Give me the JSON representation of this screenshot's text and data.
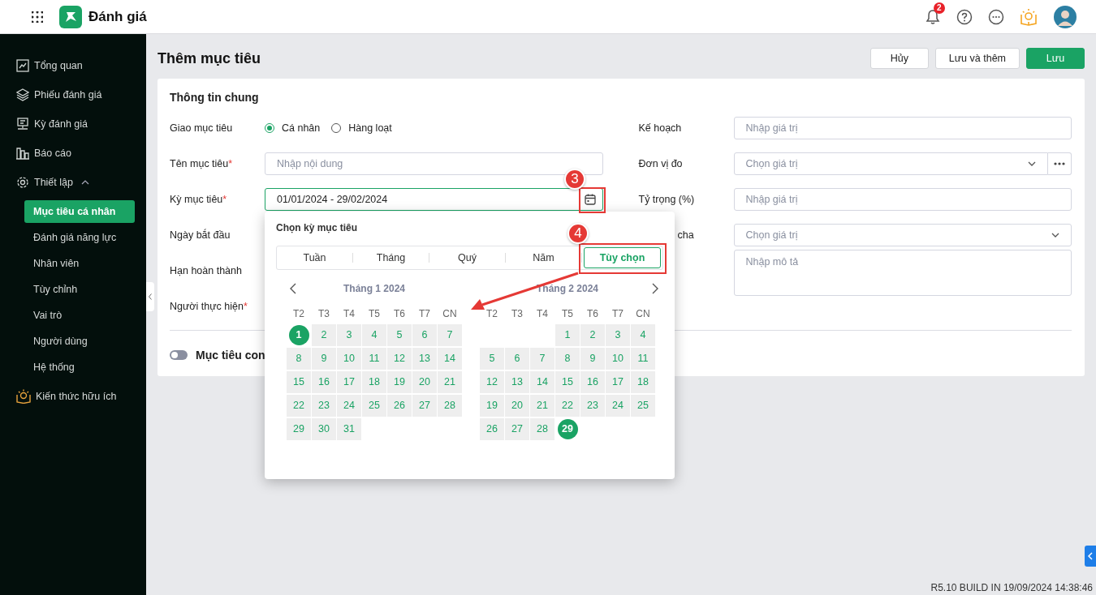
{
  "header": {
    "app_name": "Đánh giá",
    "notification_count": "2"
  },
  "sidebar": {
    "items": [
      {
        "label": "Tổng quan",
        "selected": false
      },
      {
        "label": "Phiếu đánh giá",
        "selected": false
      },
      {
        "label": "Kỳ đánh giá",
        "selected": false
      },
      {
        "label": "Báo cáo",
        "selected": false
      },
      {
        "label": "Thiết lập",
        "selected": false,
        "expanded": true,
        "children": [
          {
            "label": "Mục tiêu cá nhân",
            "selected": true
          },
          {
            "label": "Đánh giá năng lực",
            "selected": false
          },
          {
            "label": "Nhân viên",
            "selected": false
          },
          {
            "label": "Tùy chỉnh",
            "selected": false
          },
          {
            "label": "Vai trò",
            "selected": false
          },
          {
            "label": "Người dùng",
            "selected": false
          },
          {
            "label": "Hệ thống",
            "selected": false
          }
        ]
      },
      {
        "label": "Kiến thức hữu ích",
        "selected": false
      }
    ]
  },
  "page": {
    "title": "Thêm mục tiêu",
    "actions": [
      {
        "label": "Hủy",
        "kind": "secondary"
      },
      {
        "label": "Lưu và thêm",
        "kind": "secondary"
      },
      {
        "label": "Lưu",
        "kind": "primary"
      }
    ]
  },
  "form": {
    "section_title": "Thông tin chung",
    "left_fields": [
      {
        "kind": "radio",
        "label": "Giao mục tiêu",
        "options": [
          {
            "label": "Cá nhân",
            "selected": true
          },
          {
            "label": "Hàng loạt",
            "selected": false
          }
        ]
      },
      {
        "kind": "text",
        "label": "Tên mục tiêu",
        "required_mark": "*",
        "placeholder": "Nhập nội dung"
      },
      {
        "kind": "date_range",
        "label": "Kỳ mục tiêu",
        "required_mark": "*",
        "value": "01/01/2024 - 29/02/2024",
        "focused": true
      },
      {
        "kind": "covered",
        "label": "Ngày bắt đầu"
      },
      {
        "kind": "covered",
        "label": "Hạn hoàn thành"
      },
      {
        "kind": "covered",
        "label": "Người thực hiện",
        "required_mark": "*"
      }
    ],
    "right_fields": [
      {
        "kind": "text",
        "label": "Kế hoạch",
        "placeholder": "Nhập giá trị"
      },
      {
        "kind": "select_more",
        "label": "Đơn vị đo",
        "placeholder": "Chọn giá trị"
      },
      {
        "kind": "text",
        "label": "Tỷ trọng (%)",
        "placeholder": "Nhập giá trị"
      },
      {
        "kind": "select",
        "label": "cha",
        "label_clipped": true,
        "placeholder": "Chọn giá trị"
      },
      {
        "kind": "textarea",
        "placeholder": "Nhập mô tả"
      }
    ],
    "subgoal_toggle": {
      "label": "Mục tiêu con",
      "on": false
    }
  },
  "period_picker": {
    "title": "Chọn kỳ mục tiêu",
    "tabs": [
      {
        "label": "Tuần",
        "selected": false
      },
      {
        "label": "Tháng",
        "selected": false
      },
      {
        "label": "Quý",
        "selected": false
      },
      {
        "label": "Năm",
        "selected": false
      },
      {
        "label": "Tùy chọn",
        "selected": true
      }
    ],
    "months": [
      {
        "title": "Tháng 1 2024",
        "weekdays": [
          "T2",
          "T3",
          "T4",
          "T5",
          "T6",
          "T7",
          "CN"
        ],
        "weeks": [
          [
            {
              "day": "1",
              "selected": true
            },
            {
              "day": "2",
              "selected": false
            },
            {
              "day": "3",
              "selected": false
            },
            {
              "day": "4",
              "selected": false
            },
            {
              "day": "5",
              "selected": false
            },
            {
              "day": "6",
              "selected": false
            },
            {
              "day": "7",
              "selected": false
            }
          ],
          [
            {
              "day": "8",
              "selected": false
            },
            {
              "day": "9",
              "selected": false
            },
            {
              "day": "10",
              "selected": false
            },
            {
              "day": "11",
              "selected": false
            },
            {
              "day": "12",
              "selected": false
            },
            {
              "day": "13",
              "selected": false
            },
            {
              "day": "14",
              "selected": false
            }
          ],
          [
            {
              "day": "15",
              "selected": false
            },
            {
              "day": "16",
              "selected": false
            },
            {
              "day": "17",
              "selected": false
            },
            {
              "day": "18",
              "selected": false
            },
            {
              "day": "19",
              "selected": false
            },
            {
              "day": "20",
              "selected": false
            },
            {
              "day": "21",
              "selected": false
            }
          ],
          [
            {
              "day": "22",
              "selected": false
            },
            {
              "day": "23",
              "selected": false
            },
            {
              "day": "24",
              "selected": false
            },
            {
              "day": "25",
              "selected": false
            },
            {
              "day": "26",
              "selected": false
            },
            {
              "day": "27",
              "selected": false
            },
            {
              "day": "28",
              "selected": false
            }
          ],
          [
            {
              "day": "29",
              "selected": false
            },
            {
              "day": "30",
              "selected": false
            },
            {
              "day": "31",
              "selected": false
            }
          ]
        ]
      },
      {
        "title": "Tháng 2 2024",
        "weekdays": [
          "T2",
          "T3",
          "T4",
          "T5",
          "T6",
          "T7",
          "CN"
        ],
        "weeks": [
          [
            {
              "kind": "blank"
            },
            {
              "kind": "blank"
            },
            {
              "kind": "blank"
            },
            {
              "day": "1",
              "selected": false
            },
            {
              "day": "2",
              "selected": false
            },
            {
              "day": "3",
              "selected": false
            },
            {
              "day": "4",
              "selected": false
            }
          ],
          [
            {
              "day": "5",
              "selected": false
            },
            {
              "day": "6",
              "selected": false
            },
            {
              "day": "7",
              "selected": false
            },
            {
              "day": "8",
              "selected": false
            },
            {
              "day": "9",
              "selected": false
            },
            {
              "day": "10",
              "selected": false
            },
            {
              "day": "11",
              "selected": false
            }
          ],
          [
            {
              "day": "12",
              "selected": false
            },
            {
              "day": "13",
              "selected": false
            },
            {
              "day": "14",
              "selected": false
            },
            {
              "day": "15",
              "selected": false
            },
            {
              "day": "16",
              "selected": false
            },
            {
              "day": "17",
              "selected": false
            },
            {
              "day": "18",
              "selected": false
            }
          ],
          [
            {
              "day": "19",
              "selected": false
            },
            {
              "day": "20",
              "selected": false
            },
            {
              "day": "21",
              "selected": false
            },
            {
              "day": "22",
              "selected": false
            },
            {
              "day": "23",
              "selected": false
            },
            {
              "day": "24",
              "selected": false
            },
            {
              "day": "25",
              "selected": false
            }
          ],
          [
            {
              "day": "26",
              "selected": false
            },
            {
              "day": "27",
              "selected": false
            },
            {
              "day": "28",
              "selected": false
            },
            {
              "day": "29",
              "selected": true
            }
          ]
        ]
      }
    ]
  },
  "annotations": [
    {
      "label": "3"
    },
    {
      "label": "4"
    }
  ],
  "footer": {
    "build": "R5.10 BUILD IN 19/09/2024 14:38:46"
  }
}
